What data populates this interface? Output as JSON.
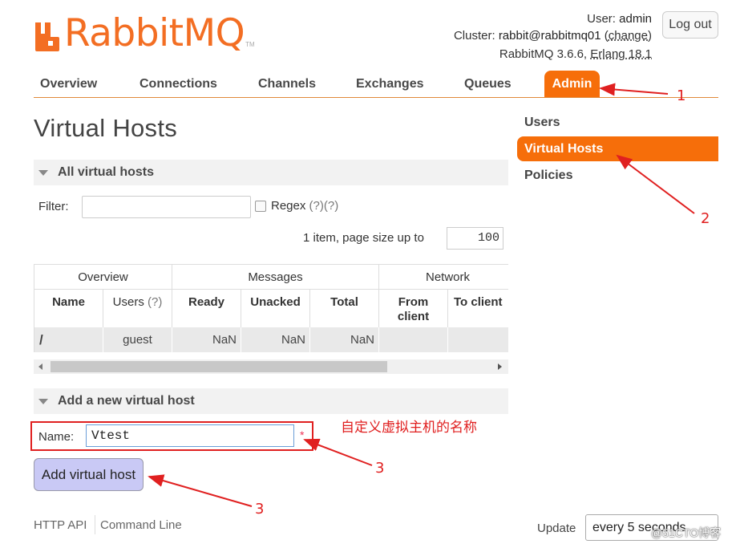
{
  "header": {
    "logo_text": "RabbitMQ",
    "logo_tm": "TM",
    "user_label": "User:",
    "user_value": "admin",
    "cluster_label": "Cluster:",
    "cluster_value": "rabbit@rabbitmq01",
    "cluster_change": "change",
    "version_text": "RabbitMQ 3.6.6,",
    "erlang_text": "Erlang 18.1",
    "logout_label": "Log out"
  },
  "nav": {
    "tabs": [
      "Overview",
      "Connections",
      "Channels",
      "Exchanges",
      "Queues",
      "Admin"
    ],
    "active": "Admin"
  },
  "sidebar": {
    "items": [
      "Users",
      "Virtual Hosts",
      "Policies"
    ],
    "active": "Virtual Hosts"
  },
  "page": {
    "title": "Virtual Hosts",
    "all_section": "All virtual hosts",
    "filter_label": "Filter:",
    "filter_value": "",
    "regex_label": "Regex",
    "regex_help": "(?)(?)",
    "items_info": "1 item, page size up to",
    "page_size": "100"
  },
  "table": {
    "groups": [
      "Overview",
      "Messages",
      "Network"
    ],
    "columns": [
      "Name",
      "Users",
      "(?)",
      "Ready",
      "Unacked",
      "Total",
      "From client",
      "To client"
    ],
    "rows": [
      {
        "name": "/",
        "users": "guest",
        "ready": "NaN",
        "unacked": "NaN",
        "total": "NaN",
        "from_client": "",
        "to_client": ""
      }
    ]
  },
  "add_form": {
    "section": "Add a new virtual host",
    "name_label": "Name:",
    "name_value": "Vtest",
    "required_mark": "*",
    "submit_label": "Add virtual host"
  },
  "annotations": {
    "note": "自定义虚拟主机的名称",
    "n1": "1",
    "n2": "2",
    "n3a": "3",
    "n3b": "3",
    "color": "#e02020"
  },
  "footer": {
    "http_api": "HTTP API",
    "command_line": "Command Line",
    "update_label": "Update",
    "update_value": "every 5 seconds",
    "watermark": "@51CTO博客"
  },
  "colors": {
    "brand": "#f66e0a",
    "logo": "#f36e23",
    "button": "#c9c9f5"
  }
}
